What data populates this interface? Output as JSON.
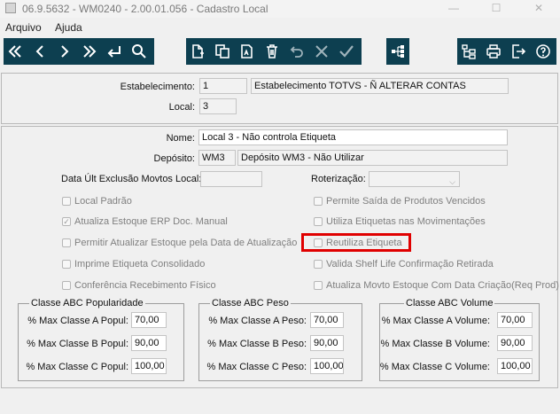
{
  "window": {
    "title": "06.9.5632 - WM0240 - 2.00.01.056 - Cadastro Local",
    "minimize": "—",
    "maximize": "☐",
    "close": "✕"
  },
  "menu": {
    "file": "Arquivo",
    "help": "Ajuda"
  },
  "toolbar": {
    "nav_icons": [
      "first-icon",
      "previous-icon",
      "next-icon",
      "last-icon",
      "goto-icon",
      "search-icon"
    ],
    "edit_icons": [
      "new-icon",
      "copy-icon",
      "edit-icon",
      "delete-icon",
      "undo-icon",
      "cancel-icon",
      "save-icon"
    ],
    "extra_icons": [
      "hierarchy-icon"
    ],
    "right_icons": [
      "structure-icon",
      "print-icon",
      "exit-icon",
      "help-icon"
    ]
  },
  "header": {
    "estabelecimento_label": "Estabelecimento:",
    "estabelecimento_code": "1",
    "estabelecimento_name": "Estabelecimento TOTVS - Ñ ALTERAR CONTAS",
    "local_label": "Local:",
    "local_code": "3"
  },
  "form": {
    "nome_label": "Nome:",
    "nome_value": "Local 3 - Não controla Etiqueta",
    "deposito_label": "Depósito:",
    "deposito_code": "WM3",
    "deposito_name": "Depósito WM3 - Não Utilizar",
    "data_label": "Data Últ Exclusão Movtos Local:",
    "data_value": "",
    "roteirizacao_label": "Roterização:",
    "roteirizacao_value": ""
  },
  "checkboxes_left": [
    {
      "label": "Local Padrão",
      "checked": false
    },
    {
      "label": "Atualiza Estoque ERP Doc. Manual",
      "checked": true
    },
    {
      "label": "Permitir Atualizar Estoque pela Data de Atualização",
      "checked": false
    },
    {
      "label": "Imprime Etiqueta Consolidado",
      "checked": false
    },
    {
      "label": "Conferência Recebimento Físico",
      "checked": false
    }
  ],
  "checkboxes_right": [
    {
      "label": "Permite Saída de Produtos Vencidos",
      "checked": false
    },
    {
      "label": "Utiliza Etiquetas nas Movimentações",
      "checked": false
    },
    {
      "label": "Reutiliza Etiqueta",
      "checked": false
    },
    {
      "label": "Valida Shelf Life Confirmação Retirada",
      "checked": false
    },
    {
      "label": "Atualiza Movto Estoque Com Data Criação(Req Prod)",
      "checked": false
    }
  ],
  "groups": [
    {
      "title": "Classe ABC Popularidade",
      "rows": [
        {
          "label": "% Max Classe A Popul:",
          "value": "70,00"
        },
        {
          "label": "% Max Classe B Popul:",
          "value": "90,00"
        },
        {
          "label": "% Max Classe C Popul:",
          "value": "100,00"
        }
      ]
    },
    {
      "title": "Classe ABC Peso",
      "rows": [
        {
          "label": "% Max Classe A Peso:",
          "value": "70,00"
        },
        {
          "label": "% Max Classe B Peso:",
          "value": "90,00"
        },
        {
          "label": "% Max Classe C Peso:",
          "value": "100,00"
        }
      ]
    },
    {
      "title": "Classe ABC Volume",
      "rows": [
        {
          "label": "% Max Classe A Volume:",
          "value": "70,00"
        },
        {
          "label": "% Max Classe B Volume:",
          "value": "90,00"
        },
        {
          "label": "% Max Classe C Volume:",
          "value": "100,00"
        }
      ]
    }
  ],
  "colors": {
    "toolbar_bg": "#0d3f50",
    "highlight": "#e00000"
  }
}
